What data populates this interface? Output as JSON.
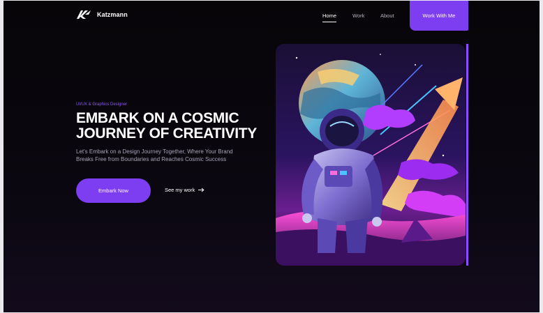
{
  "brand": {
    "name": "Katzmann",
    "logo_icon": "katzmann-logo-mark"
  },
  "nav": {
    "items": [
      {
        "label": "Home",
        "active": true
      },
      {
        "label": "Work",
        "active": false
      },
      {
        "label": "About",
        "active": false
      }
    ],
    "cta_label": "Work With Me"
  },
  "hero": {
    "eyebrow": "UI/UX & Graphics Designer",
    "headline": [
      "EMBARK ON A COSMIC",
      "JOURNEY OF CREATIVITY"
    ],
    "description": [
      "Let's Embark on a Design Journey Together, Where Your Brand",
      "Breaks Free from Boundaries and Reaches Cosmic Success"
    ],
    "primary_button": "Embark Now",
    "secondary_link": "See my work",
    "secondary_icon": "arrow-right-icon"
  },
  "illustration": {
    "subject": "astronaut-space-illustration"
  },
  "colors": {
    "accent": "#7d3df0",
    "background": "#070508",
    "text": "#ffffff",
    "muted": "#a8a2b4"
  }
}
